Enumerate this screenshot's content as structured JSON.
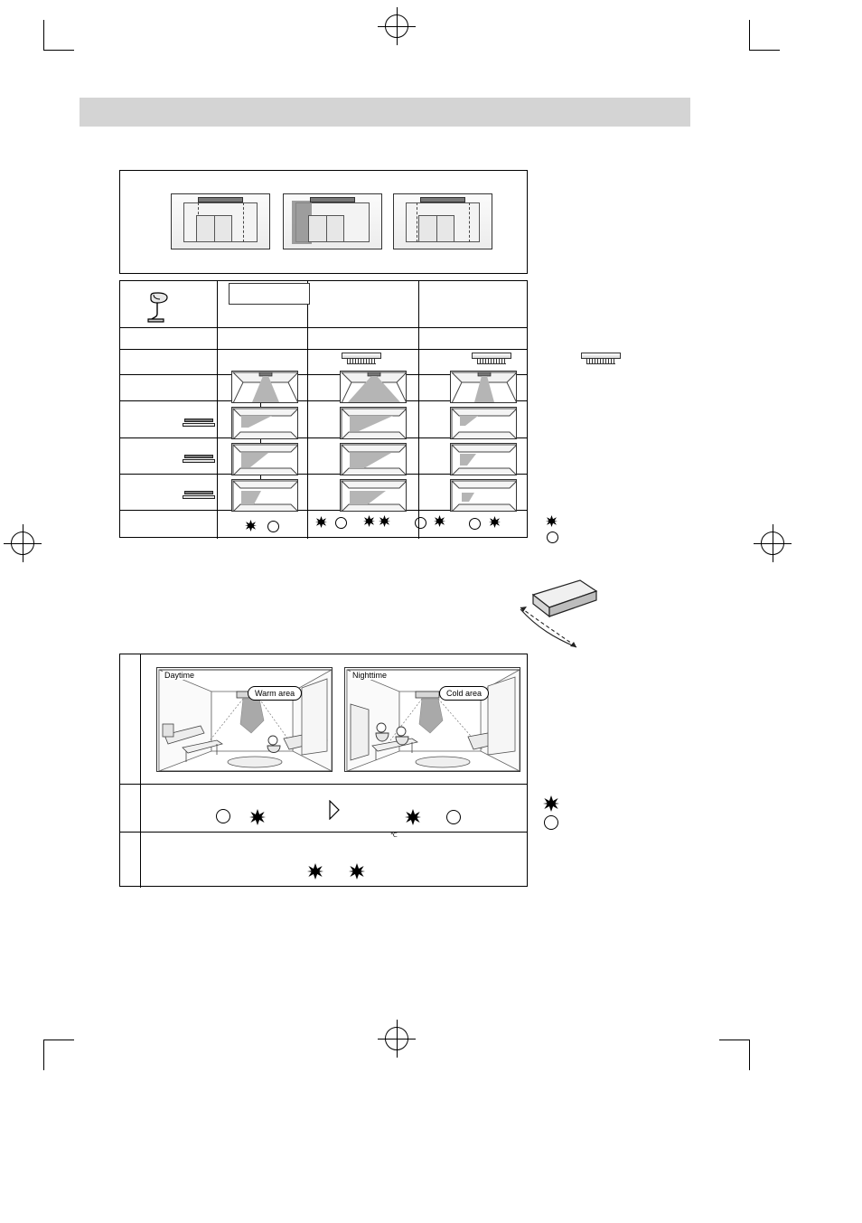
{
  "page": {
    "header_bar_color": "#d4d4d4",
    "background": "#ffffff"
  },
  "room_panel": {
    "name": "airflow-room-illustrations",
    "thumbs": [
      {
        "id": "room-thumb-1",
        "shade": "none"
      },
      {
        "id": "room-thumb-2",
        "shade": "left"
      },
      {
        "id": "room-thumb-3",
        "shade": "none"
      }
    ]
  },
  "spec_table": {
    "icon": "desk-lamp-icon",
    "columns": [
      "",
      "",
      ""
    ],
    "rows": [
      {
        "name": "header-row",
        "label": ""
      },
      {
        "name": "unit-glyph-row",
        "label": ""
      },
      {
        "name": "room-overview-row",
        "label": ""
      },
      {
        "name": "airflow-row-1",
        "label": ""
      },
      {
        "name": "airflow-row-2",
        "label": ""
      },
      {
        "name": "airflow-row-3",
        "label": ""
      },
      {
        "name": "symbol-row",
        "label": ""
      }
    ],
    "symbol_row": {
      "col1": [
        "filled",
        "open"
      ],
      "col2": [
        "filled",
        "open",
        "filled",
        "filled",
        "open",
        "filled"
      ],
      "col3": [
        "open",
        "filled"
      ]
    },
    "legend": [
      "filled",
      "open"
    ]
  },
  "lower_table": {
    "scenes": [
      {
        "name": "scene-daytime",
        "label": "Daytime",
        "bubble": "Warm area"
      },
      {
        "name": "scene-nighttime",
        "label": "Nighttime",
        "bubble": "Cold area"
      }
    ],
    "symbol_row": {
      "left": [
        "open",
        "filled"
      ],
      "arrow": "play-triangle",
      "right": [
        "filled",
        "open"
      ]
    },
    "unit_label": "℃",
    "bottom_row": [
      "filled",
      "filled"
    ],
    "legend": [
      "filled",
      "open"
    ]
  }
}
